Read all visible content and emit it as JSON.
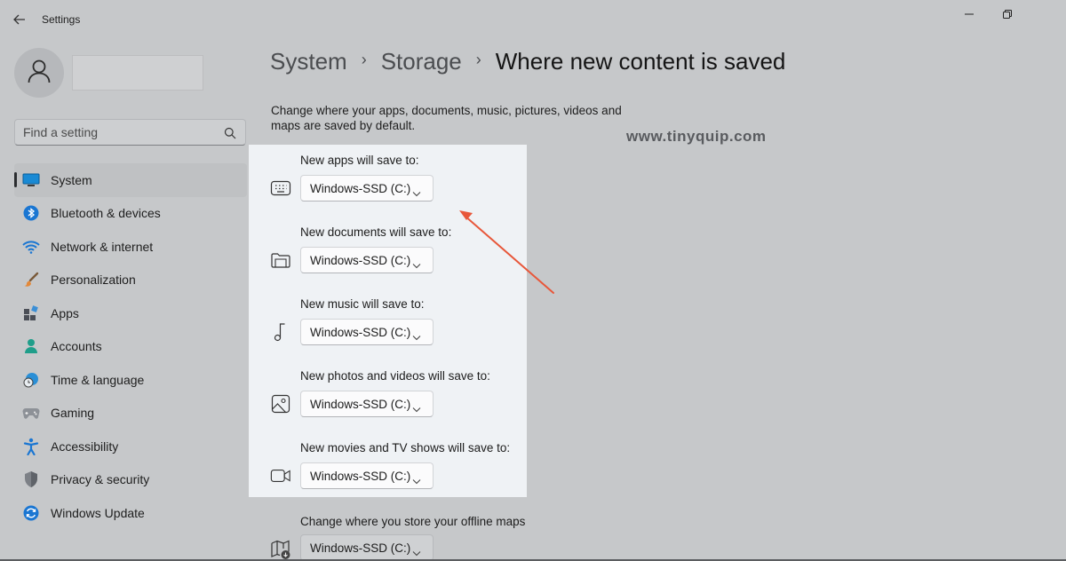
{
  "window": {
    "title": "Settings",
    "back_icon": "arrow-left-icon",
    "minimize_icon": "minimize-icon",
    "restore_icon": "restore-icon"
  },
  "user": {
    "avatar_icon": "person-icon"
  },
  "search": {
    "placeholder": "Find a setting",
    "icon": "search-icon"
  },
  "sidebar": {
    "items": [
      {
        "label": "System",
        "icon": "monitor-icon",
        "active": true
      },
      {
        "label": "Bluetooth & devices",
        "icon": "bluetooth-icon"
      },
      {
        "label": "Network & internet",
        "icon": "wifi-icon"
      },
      {
        "label": "Personalization",
        "icon": "brush-icon"
      },
      {
        "label": "Apps",
        "icon": "apps-icon"
      },
      {
        "label": "Accounts",
        "icon": "account-icon"
      },
      {
        "label": "Time & language",
        "icon": "globe-clock-icon"
      },
      {
        "label": "Gaming",
        "icon": "gamepad-icon"
      },
      {
        "label": "Accessibility",
        "icon": "accessibility-icon"
      },
      {
        "label": "Privacy & security",
        "icon": "shield-icon"
      },
      {
        "label": "Windows Update",
        "icon": "update-icon"
      }
    ]
  },
  "breadcrumb": {
    "items": [
      "System",
      "Storage",
      "Where new content is saved"
    ],
    "separator": "›"
  },
  "description": "Change where your apps, documents, music, pictures, videos and maps are saved by default.",
  "watermark": "www.tinyquip.com",
  "settings": [
    {
      "label": "New apps will save to:",
      "value": "Windows-SSD (C:)",
      "icon": "apps-storage-icon"
    },
    {
      "label": "New documents will save to:",
      "value": "Windows-SSD (C:)",
      "icon": "folder-icon"
    },
    {
      "label": "New music will save to:",
      "value": "Windows-SSD (C:)",
      "icon": "music-note-icon"
    },
    {
      "label": "New photos and videos will save to:",
      "value": "Windows-SSD (C:)",
      "icon": "image-icon"
    },
    {
      "label": "New movies and TV shows will save to:",
      "value": "Windows-SSD (C:)",
      "icon": "video-camera-icon"
    },
    {
      "label": "Change where you store your offline maps",
      "value": "Windows-SSD (C:)",
      "icon": "map-download-icon"
    }
  ],
  "colors": {
    "accent": "#0067c0",
    "annotation_arrow": "#e8573a",
    "card": "#eff2f5",
    "overlay": "#c6c8ca"
  }
}
